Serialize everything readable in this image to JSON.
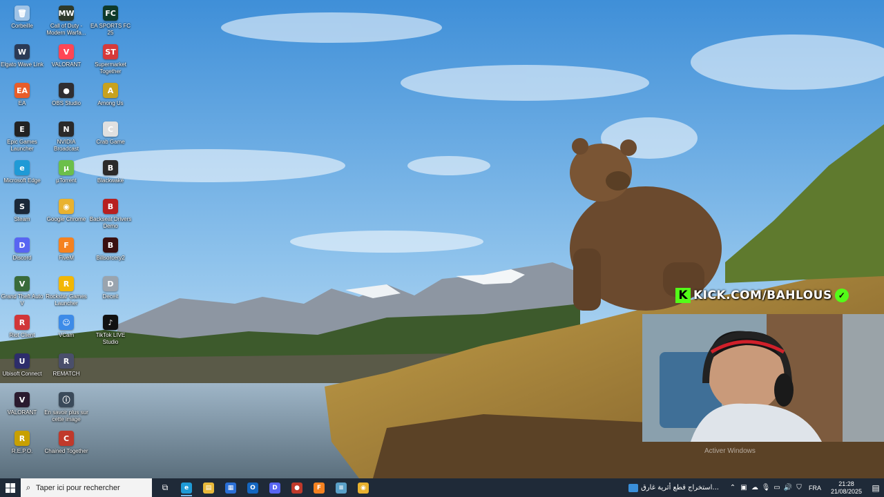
{
  "desktop_icons": [
    {
      "label": "Corbeille",
      "icon": "recycle-bin-icon",
      "color": "#9fc3e6",
      "glyph": "🗑"
    },
    {
      "label": "Elgato Wave Link",
      "icon": "elgato-icon",
      "color": "#2b3a55",
      "glyph": "W"
    },
    {
      "label": "EA",
      "icon": "ea-icon",
      "color": "#e85d2a",
      "glyph": "EA"
    },
    {
      "label": "Epic Games Launcher",
      "icon": "epic-games-icon",
      "color": "#222222",
      "glyph": "E"
    },
    {
      "label": "Microsoft Edge",
      "icon": "edge-icon",
      "color": "#1f9ad6",
      "glyph": "e"
    },
    {
      "label": "Steam",
      "icon": "steam-icon",
      "color": "#1b2838",
      "glyph": "S"
    },
    {
      "label": "Discord",
      "icon": "discord-icon",
      "color": "#5865f2",
      "glyph": "D"
    },
    {
      "label": "Grand Theft Auto V",
      "icon": "gta-icon",
      "color": "#3a6b3a",
      "glyph": "V"
    },
    {
      "label": "Riot Client",
      "icon": "riot-icon",
      "color": "#d13639",
      "glyph": "R"
    },
    {
      "label": "Ubisoft Connect",
      "icon": "ubisoft-icon",
      "color": "#2d2d6b",
      "glyph": "U"
    },
    {
      "label": "VALORANT",
      "icon": "valorant-icon",
      "color": "#2a1a2e",
      "glyph": "V"
    },
    {
      "label": "R.E.P.O.",
      "icon": "repo-icon",
      "color": "#c8a000",
      "glyph": "R"
    },
    {
      "label": "Call of Duty - Modern Warfa...",
      "icon": "cod-icon",
      "color": "#2f3a2a",
      "glyph": "MW"
    },
    {
      "label": "VALORANT",
      "icon": "valorant-icon",
      "color": "#ff4655",
      "glyph": "V"
    },
    {
      "label": "OBS Studio",
      "icon": "obs-icon",
      "color": "#302e31",
      "glyph": "●"
    },
    {
      "label": "NVIDIA Broadcast",
      "icon": "nvidia-icon",
      "color": "#2a2a2a",
      "glyph": "N"
    },
    {
      "label": "µTorrent",
      "icon": "utorrent-icon",
      "color": "#6cbf4a",
      "glyph": "µ"
    },
    {
      "label": "Google Chrome",
      "icon": "chrome-icon",
      "color": "#e9b22f",
      "glyph": "◉"
    },
    {
      "label": "FiveM",
      "icon": "fivem-icon",
      "color": "#f58220",
      "glyph": "F"
    },
    {
      "label": "Rockstar Games Launcher",
      "icon": "rockstar-icon",
      "color": "#f2b705",
      "glyph": "R"
    },
    {
      "label": "VCam",
      "icon": "vcam-icon",
      "color": "#3d8be8",
      "glyph": "☺"
    },
    {
      "label": "REMATCH",
      "icon": "rematch-icon",
      "color": "#4a4f6b",
      "glyph": "R"
    },
    {
      "label": "En savoir plus sur cette image",
      "icon": "info-camera-icon",
      "color": "#3a4a5a",
      "glyph": "ⓘ"
    },
    {
      "label": "Chained Together",
      "icon": "chained-together-icon",
      "color": "#c0392b",
      "glyph": "C"
    },
    {
      "label": "EA SPORTS FC 25",
      "icon": "ea-fc-icon",
      "color": "#0f3a2a",
      "glyph": "FC"
    },
    {
      "label": "Supermarket Together",
      "icon": "supermarket-icon",
      "color": "#d63a3a",
      "glyph": "ST"
    },
    {
      "label": "Among Us",
      "icon": "among-us-icon",
      "color": "#c8a21e",
      "glyph": "A"
    },
    {
      "label": "Crab Game",
      "icon": "crab-game-icon",
      "color": "#e0e0e0",
      "glyph": "C"
    },
    {
      "label": "Blackwake",
      "icon": "blackwake-icon",
      "color": "#2a2a2a",
      "glyph": "B"
    },
    {
      "label": "Backseat Drivers Demo",
      "icon": "backseat-drivers-icon",
      "color": "#b72020",
      "glyph": "B"
    },
    {
      "label": "Billsorcery2",
      "icon": "billsorcery-icon",
      "color": "#3a1010",
      "glyph": "B"
    },
    {
      "label": "Deceit",
      "icon": "deceit-icon",
      "color": "#9aa4ae",
      "glyph": "D"
    },
    {
      "label": "TikTok LIVE Studio",
      "icon": "tiktok-icon",
      "color": "#111111",
      "glyph": "♪"
    }
  ],
  "overlay": {
    "kick_text": "KICK.COM/BAHLOUS",
    "kick_logo": "K",
    "activate_note": "Activer Windows"
  },
  "taskbar": {
    "search_placeholder": "Taper ici pour rechercher",
    "apps": [
      {
        "name": "edge",
        "icon": "edge-icon",
        "color": "#1f9ad6",
        "glyph": "e",
        "active": true
      },
      {
        "name": "file-explorer",
        "icon": "folder-icon",
        "color": "#e8b93a",
        "glyph": "▤",
        "active": false
      },
      {
        "name": "store",
        "icon": "store-icon",
        "color": "#2a6fd6",
        "glyph": "▦",
        "active": false
      },
      {
        "name": "outlook",
        "icon": "outlook-icon",
        "color": "#1466c0",
        "glyph": "O",
        "active": false
      },
      {
        "name": "discord",
        "icon": "discord-icon",
        "color": "#5865f2",
        "glyph": "D",
        "active": false
      },
      {
        "name": "app-red",
        "icon": "game-icon",
        "color": "#c0392b",
        "glyph": "●",
        "active": false
      },
      {
        "name": "fivem",
        "icon": "fivem-icon",
        "color": "#f58220",
        "glyph": "F",
        "active": false
      },
      {
        "name": "notes",
        "icon": "notepad-icon",
        "color": "#5aa0c8",
        "glyph": "≡",
        "active": false
      },
      {
        "name": "chrome",
        "icon": "chrome-icon",
        "color": "#e9b22f",
        "glyph": "◉",
        "active": false
      }
    ],
    "news_text": "استخراج قطع أثرية غارق...",
    "language": "FRA",
    "time": "21:28",
    "date": "21/08/2025"
  }
}
